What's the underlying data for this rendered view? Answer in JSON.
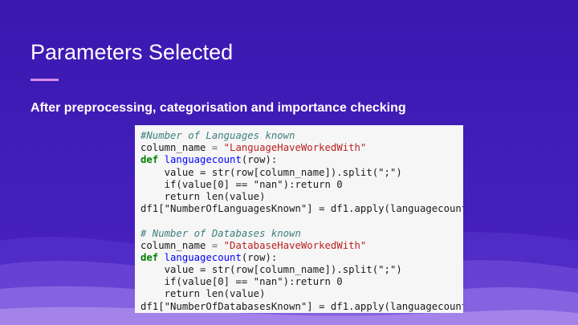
{
  "slide": {
    "title": "Parameters Selected",
    "subtitle": "After preprocessing, categorisation and importance checking"
  },
  "code": {
    "block1": {
      "comment": "#Number of Languages known",
      "assign_var": "column_name",
      "assign_value": "\"LanguageHaveWorkedWith\"",
      "def_kw": "def",
      "func_name": "languagecount",
      "func_args": "(row):",
      "value_line": "    value = str(row[column_name]).split(\";\")",
      "if_line": "    if(value[0] == \"nan\"):return 0",
      "return_line": "    return len(value)",
      "apply_line": "df1[\"NumberOfLanguagesKnown\"] = df1.apply(languagecount"
    },
    "block2": {
      "comment": "# Number of Databases known",
      "assign_var": "column_name",
      "assign_value": "\"DatabaseHaveWorkedWith\"",
      "def_kw": "def",
      "func_name": "languagecount",
      "func_args": "(row):",
      "value_line": "    value = str(row[column_name]).split(\";\")",
      "if_line": "    if(value[0] == \"nan\"):return 0",
      "return_line": "    return len(value)",
      "apply_line": "df1[\"NumberOfDatabasesKnown\"] = df1.apply(languagecount"
    }
  },
  "colors": {
    "background": "#3d1bb5",
    "accent": "#d98be6",
    "code_background": "#f6f6f6"
  }
}
